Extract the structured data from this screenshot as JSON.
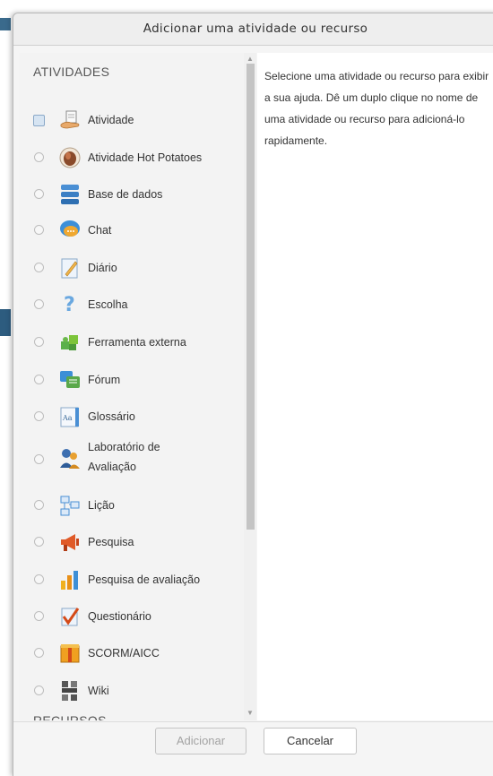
{
  "dialog": {
    "title": "Adicionar uma atividade ou recurso"
  },
  "options": {
    "activities_heading": "ATIVIDADES",
    "resources_heading": "RECURSOS",
    "items": [
      {
        "label": "Atividade",
        "icon": "assignment-hand-icon",
        "selected": true
      },
      {
        "label": "Atividade Hot Potatoes",
        "icon": "hot-potatoes-icon",
        "selected": false
      },
      {
        "label": "Base de dados",
        "icon": "database-icon",
        "selected": false
      },
      {
        "label": "Chat",
        "icon": "chat-bubble-icon",
        "selected": false
      },
      {
        "label": "Diário",
        "icon": "journal-pencil-icon",
        "selected": false
      },
      {
        "label": "Escolha",
        "icon": "question-mark-icon",
        "selected": false
      },
      {
        "label": "Ferramenta externa",
        "icon": "puzzle-piece-icon",
        "selected": false
      },
      {
        "label": "Fórum",
        "icon": "forum-icon",
        "selected": false
      },
      {
        "label": "Glossário",
        "icon": "glossary-book-icon",
        "selected": false
      },
      {
        "label_line1": "Laboratório de",
        "label_line2": "Avaliação",
        "icon": "workshop-people-icon",
        "selected": false
      },
      {
        "label": "Lição",
        "icon": "lesson-flowchart-icon",
        "selected": false
      },
      {
        "label": "Pesquisa",
        "icon": "megaphone-icon",
        "selected": false
      },
      {
        "label": "Pesquisa de avaliação",
        "icon": "bar-chart-icon",
        "selected": false
      },
      {
        "label": "Questionário",
        "icon": "checkmark-quiz-icon",
        "selected": false
      },
      {
        "label": "SCORM/AICC",
        "icon": "scorm-package-icon",
        "selected": false
      },
      {
        "label": "Wiki",
        "icon": "wiki-icon",
        "selected": false
      }
    ]
  },
  "help": {
    "line1": "Selecione uma atividade ou recurso para exibir",
    "line2": "a sua ajuda. Dê um duplo clique no nome de",
    "line3": "uma atividade ou recurso para adicioná-lo",
    "line4": "rapidamente."
  },
  "footer": {
    "add_label": "Adicionar",
    "cancel_label": "Cancelar"
  }
}
